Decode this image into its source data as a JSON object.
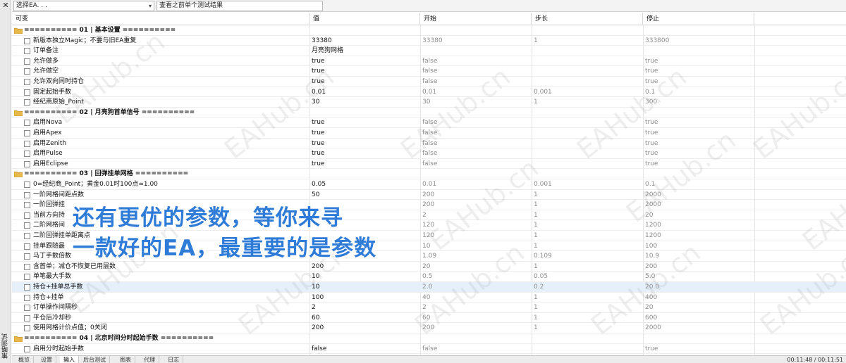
{
  "window": {
    "close_glyph": "✕",
    "vertical_title": "策略测试"
  },
  "toolbar": {
    "ea_select_value": "选择EA. . .",
    "view_button": "查看之前单个测试结果"
  },
  "table": {
    "headers": [
      "可变",
      "值",
      "开始",
      "步长",
      "停止"
    ],
    "rows": [
      {
        "type": "group",
        "name": "========== 01 | 基本设置 =========="
      },
      {
        "type": "param",
        "name": "新版本独立Magic；不要与旧EA重复",
        "value": "33380",
        "start": "33380",
        "step": "1",
        "stop": "333800"
      },
      {
        "type": "param",
        "name": "订单备注",
        "value": "月亮狗网格",
        "start": "",
        "step": "",
        "stop": ""
      },
      {
        "type": "param",
        "name": "允许做多",
        "value": "true",
        "start": "false",
        "step": "",
        "stop": "true"
      },
      {
        "type": "param",
        "name": "允许做空",
        "value": "true",
        "start": "false",
        "step": "",
        "stop": "true"
      },
      {
        "type": "param",
        "name": "允许双向同时持仓",
        "value": "true",
        "start": "false",
        "step": "",
        "stop": "true"
      },
      {
        "type": "param",
        "name": "固定起始手数",
        "value": "0.01",
        "start": "0.01",
        "step": "0.001",
        "stop": "0.1"
      },
      {
        "type": "param",
        "name": "经纪商原始_Point",
        "value": "30",
        "start": "30",
        "step": "1",
        "stop": "300"
      },
      {
        "type": "group",
        "name": "========== 02 | 月亮狗首单信号 =========="
      },
      {
        "type": "param",
        "name": "启用Nova",
        "value": "true",
        "start": "false",
        "step": "",
        "stop": "true"
      },
      {
        "type": "param",
        "name": "启用Apex",
        "value": "true",
        "start": "false",
        "step": "",
        "stop": "true"
      },
      {
        "type": "param",
        "name": "启用Zenith",
        "value": "true",
        "start": "false",
        "step": "",
        "stop": "true"
      },
      {
        "type": "param",
        "name": "启用Pulse",
        "value": "true",
        "start": "false",
        "step": "",
        "stop": "true"
      },
      {
        "type": "param",
        "name": "启用Eclipse",
        "value": "true",
        "start": "false",
        "step": "",
        "stop": "true"
      },
      {
        "type": "group",
        "name": "========== 03 | 回弹挂单网格 =========="
      },
      {
        "type": "param",
        "name": "0=经纪商_Point；黄金0.01时100点=1.00",
        "value": "0.05",
        "start": "0.01",
        "step": "0.001",
        "stop": "0.1"
      },
      {
        "type": "param",
        "name": "一阶网格间距点数",
        "value": "50",
        "start": "200",
        "step": "1",
        "stop": "2000"
      },
      {
        "type": "param",
        "name": "一阶回弹挂",
        "value": "",
        "start": "200",
        "step": "1",
        "stop": "2000"
      },
      {
        "type": "param",
        "name": "当前方向持",
        "value": "",
        "start": "2",
        "step": "1",
        "stop": "20"
      },
      {
        "type": "param",
        "name": "二阶网格间",
        "value": "",
        "start": "120",
        "step": "1",
        "stop": "1200"
      },
      {
        "type": "param",
        "name": "二阶回弹挂单距离点",
        "value": "",
        "start": "120",
        "step": "1",
        "stop": "1200"
      },
      {
        "type": "param",
        "name": "挂单跟随最",
        "value": "",
        "start": "10",
        "step": "1",
        "stop": "100"
      },
      {
        "type": "param",
        "name": "马丁手数倍数",
        "value": "",
        "start": "1.09",
        "step": "0.109",
        "stop": "10.9"
      },
      {
        "type": "param",
        "name": "含首单；减仓不恢复已用层数",
        "value": "200",
        "start": "20",
        "step": "1",
        "stop": "200"
      },
      {
        "type": "param",
        "name": "单笔最大手数",
        "value": "10",
        "start": "0.5",
        "step": "0.05",
        "stop": "5.0"
      },
      {
        "type": "param",
        "name": "持仓+挂单总手数",
        "value": "10",
        "start": "2.0",
        "step": "0.2",
        "stop": "20.0",
        "highlight": true
      },
      {
        "type": "param",
        "name": "持仓+挂单",
        "value": "100",
        "start": "40",
        "step": "1",
        "stop": "400"
      },
      {
        "type": "param",
        "name": "订单操作间隔秒",
        "value": "2",
        "start": "2",
        "step": "1",
        "stop": "20"
      },
      {
        "type": "param",
        "name": "平仓后冷却秒",
        "value": "60",
        "start": "60",
        "step": "1",
        "stop": "600"
      },
      {
        "type": "param",
        "name": "使用网格计价点值；0关闭",
        "value": "200",
        "start": "200",
        "step": "1",
        "stop": "2000"
      },
      {
        "type": "group",
        "name": "========== 04 | 北京时间分时起始手数 =========="
      },
      {
        "type": "param",
        "name": "启用分时起始手数",
        "value": "false",
        "start": "false",
        "step": "",
        "stop": "true"
      }
    ]
  },
  "tabs": [
    "概览",
    "设置",
    "输入",
    "后台测试",
    "图表",
    "代理",
    "日志"
  ],
  "active_tab": "输入",
  "clock": "00:11:48 / 00:11:51",
  "promo": {
    "line1": "还有更优的参数，等你来寻",
    "line2": "一款好的EA，最重要的是参数"
  },
  "watermark": "EAHub.cn",
  "colors": {
    "promo": "#2f7bd8",
    "highlight_row": "#e6f0fb",
    "folder": "#e8b84a"
  },
  "icons": {
    "group": "folder-icon",
    "param": "checkbox-icon"
  }
}
